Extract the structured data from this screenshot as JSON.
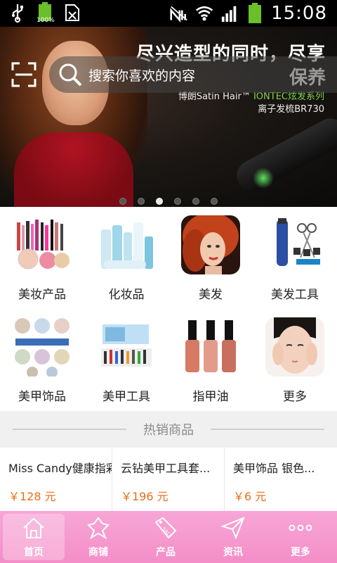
{
  "status_bar": {
    "time": "15:08",
    "battery_level_label": "100%",
    "icons": [
      "usb-icon",
      "battery-icon",
      "sim-icon",
      "no-signal-icon",
      "wifi-icon",
      "signal-icon",
      "battery-icon"
    ]
  },
  "banner": {
    "headline_line1": "尽兴造型的同时，尽享",
    "headline_line2": "保养",
    "brand_prefix": "博朗Satin Hair™ ",
    "brand_series": "IONTEC炫发系列",
    "model": "离子发梳BR730",
    "active_slide": 3,
    "slide_count": 6
  },
  "search": {
    "placeholder": "搜索你喜欢的内容"
  },
  "categories": [
    {
      "label": "美妆产品",
      "icon": "makeup-products-image"
    },
    {
      "label": "化妆品",
      "icon": "cosmetics-image"
    },
    {
      "label": "美发",
      "icon": "hair-beauty-image"
    },
    {
      "label": "美发工具",
      "icon": "hair-tools-image"
    },
    {
      "label": "美甲饰品",
      "icon": "nail-accessories-image"
    },
    {
      "label": "美甲工具",
      "icon": "nail-tools-image"
    },
    {
      "label": "指甲油",
      "icon": "nail-polish-image"
    },
    {
      "label": "更多",
      "icon": "more-image"
    }
  ],
  "hot_section": {
    "title": "热销商品"
  },
  "products": [
    {
      "name": "Miss Candy健康指彩...",
      "price": "￥128 元"
    },
    {
      "name": "云钻美甲工具套...",
      "price": "￥196 元"
    },
    {
      "name": "美甲饰品 银色...",
      "price": "￥6 元"
    }
  ],
  "bottom_nav": [
    {
      "label": "首页",
      "icon": "home-icon",
      "active": true
    },
    {
      "label": "商铺",
      "icon": "shop-icon",
      "active": false
    },
    {
      "label": "产品",
      "icon": "sale-tag-icon",
      "active": false
    },
    {
      "label": "资讯",
      "icon": "send-icon",
      "active": false
    },
    {
      "label": "更多",
      "icon": "more-dots-icon",
      "active": false
    }
  ],
  "colors": {
    "nav_pink": "#f48ec8",
    "price_orange": "#e96e17",
    "hot_bar_bg": "#f0f0f0"
  }
}
